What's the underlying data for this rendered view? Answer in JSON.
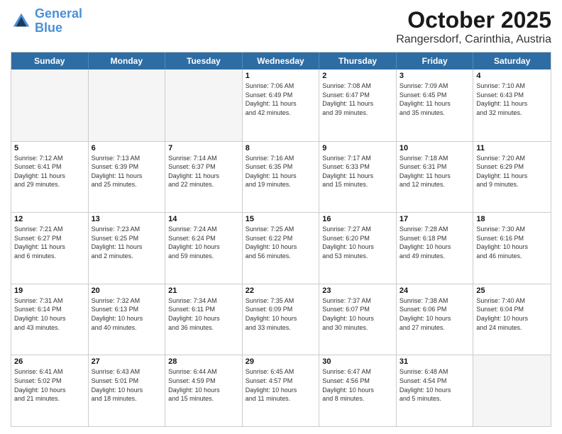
{
  "header": {
    "logo_line1": "General",
    "logo_line2": "Blue",
    "month": "October 2025",
    "location": "Rangersdorf, Carinthia, Austria"
  },
  "weekdays": [
    "Sunday",
    "Monday",
    "Tuesday",
    "Wednesday",
    "Thursday",
    "Friday",
    "Saturday"
  ],
  "weeks": [
    [
      {
        "day": "",
        "info": "",
        "empty": true
      },
      {
        "day": "",
        "info": "",
        "empty": true
      },
      {
        "day": "",
        "info": "",
        "empty": true
      },
      {
        "day": "1",
        "info": "Sunrise: 7:06 AM\nSunset: 6:49 PM\nDaylight: 11 hours\nand 42 minutes.",
        "empty": false
      },
      {
        "day": "2",
        "info": "Sunrise: 7:08 AM\nSunset: 6:47 PM\nDaylight: 11 hours\nand 39 minutes.",
        "empty": false
      },
      {
        "day": "3",
        "info": "Sunrise: 7:09 AM\nSunset: 6:45 PM\nDaylight: 11 hours\nand 35 minutes.",
        "empty": false
      },
      {
        "day": "4",
        "info": "Sunrise: 7:10 AM\nSunset: 6:43 PM\nDaylight: 11 hours\nand 32 minutes.",
        "empty": false
      }
    ],
    [
      {
        "day": "5",
        "info": "Sunrise: 7:12 AM\nSunset: 6:41 PM\nDaylight: 11 hours\nand 29 minutes.",
        "empty": false
      },
      {
        "day": "6",
        "info": "Sunrise: 7:13 AM\nSunset: 6:39 PM\nDaylight: 11 hours\nand 25 minutes.",
        "empty": false
      },
      {
        "day": "7",
        "info": "Sunrise: 7:14 AM\nSunset: 6:37 PM\nDaylight: 11 hours\nand 22 minutes.",
        "empty": false
      },
      {
        "day": "8",
        "info": "Sunrise: 7:16 AM\nSunset: 6:35 PM\nDaylight: 11 hours\nand 19 minutes.",
        "empty": false
      },
      {
        "day": "9",
        "info": "Sunrise: 7:17 AM\nSunset: 6:33 PM\nDaylight: 11 hours\nand 15 minutes.",
        "empty": false
      },
      {
        "day": "10",
        "info": "Sunrise: 7:18 AM\nSunset: 6:31 PM\nDaylight: 11 hours\nand 12 minutes.",
        "empty": false
      },
      {
        "day": "11",
        "info": "Sunrise: 7:20 AM\nSunset: 6:29 PM\nDaylight: 11 hours\nand 9 minutes.",
        "empty": false
      }
    ],
    [
      {
        "day": "12",
        "info": "Sunrise: 7:21 AM\nSunset: 6:27 PM\nDaylight: 11 hours\nand 6 minutes.",
        "empty": false
      },
      {
        "day": "13",
        "info": "Sunrise: 7:23 AM\nSunset: 6:25 PM\nDaylight: 11 hours\nand 2 minutes.",
        "empty": false
      },
      {
        "day": "14",
        "info": "Sunrise: 7:24 AM\nSunset: 6:24 PM\nDaylight: 10 hours\nand 59 minutes.",
        "empty": false
      },
      {
        "day": "15",
        "info": "Sunrise: 7:25 AM\nSunset: 6:22 PM\nDaylight: 10 hours\nand 56 minutes.",
        "empty": false
      },
      {
        "day": "16",
        "info": "Sunrise: 7:27 AM\nSunset: 6:20 PM\nDaylight: 10 hours\nand 53 minutes.",
        "empty": false
      },
      {
        "day": "17",
        "info": "Sunrise: 7:28 AM\nSunset: 6:18 PM\nDaylight: 10 hours\nand 49 minutes.",
        "empty": false
      },
      {
        "day": "18",
        "info": "Sunrise: 7:30 AM\nSunset: 6:16 PM\nDaylight: 10 hours\nand 46 minutes.",
        "empty": false
      }
    ],
    [
      {
        "day": "19",
        "info": "Sunrise: 7:31 AM\nSunset: 6:14 PM\nDaylight: 10 hours\nand 43 minutes.",
        "empty": false
      },
      {
        "day": "20",
        "info": "Sunrise: 7:32 AM\nSunset: 6:13 PM\nDaylight: 10 hours\nand 40 minutes.",
        "empty": false
      },
      {
        "day": "21",
        "info": "Sunrise: 7:34 AM\nSunset: 6:11 PM\nDaylight: 10 hours\nand 36 minutes.",
        "empty": false
      },
      {
        "day": "22",
        "info": "Sunrise: 7:35 AM\nSunset: 6:09 PM\nDaylight: 10 hours\nand 33 minutes.",
        "empty": false
      },
      {
        "day": "23",
        "info": "Sunrise: 7:37 AM\nSunset: 6:07 PM\nDaylight: 10 hours\nand 30 minutes.",
        "empty": false
      },
      {
        "day": "24",
        "info": "Sunrise: 7:38 AM\nSunset: 6:06 PM\nDaylight: 10 hours\nand 27 minutes.",
        "empty": false
      },
      {
        "day": "25",
        "info": "Sunrise: 7:40 AM\nSunset: 6:04 PM\nDaylight: 10 hours\nand 24 minutes.",
        "empty": false
      }
    ],
    [
      {
        "day": "26",
        "info": "Sunrise: 6:41 AM\nSunset: 5:02 PM\nDaylight: 10 hours\nand 21 minutes.",
        "empty": false
      },
      {
        "day": "27",
        "info": "Sunrise: 6:43 AM\nSunset: 5:01 PM\nDaylight: 10 hours\nand 18 minutes.",
        "empty": false
      },
      {
        "day": "28",
        "info": "Sunrise: 6:44 AM\nSunset: 4:59 PM\nDaylight: 10 hours\nand 15 minutes.",
        "empty": false
      },
      {
        "day": "29",
        "info": "Sunrise: 6:45 AM\nSunset: 4:57 PM\nDaylight: 10 hours\nand 11 minutes.",
        "empty": false
      },
      {
        "day": "30",
        "info": "Sunrise: 6:47 AM\nSunset: 4:56 PM\nDaylight: 10 hours\nand 8 minutes.",
        "empty": false
      },
      {
        "day": "31",
        "info": "Sunrise: 6:48 AM\nSunset: 4:54 PM\nDaylight: 10 hours\nand 5 minutes.",
        "empty": false
      },
      {
        "day": "",
        "info": "",
        "empty": true
      }
    ]
  ]
}
